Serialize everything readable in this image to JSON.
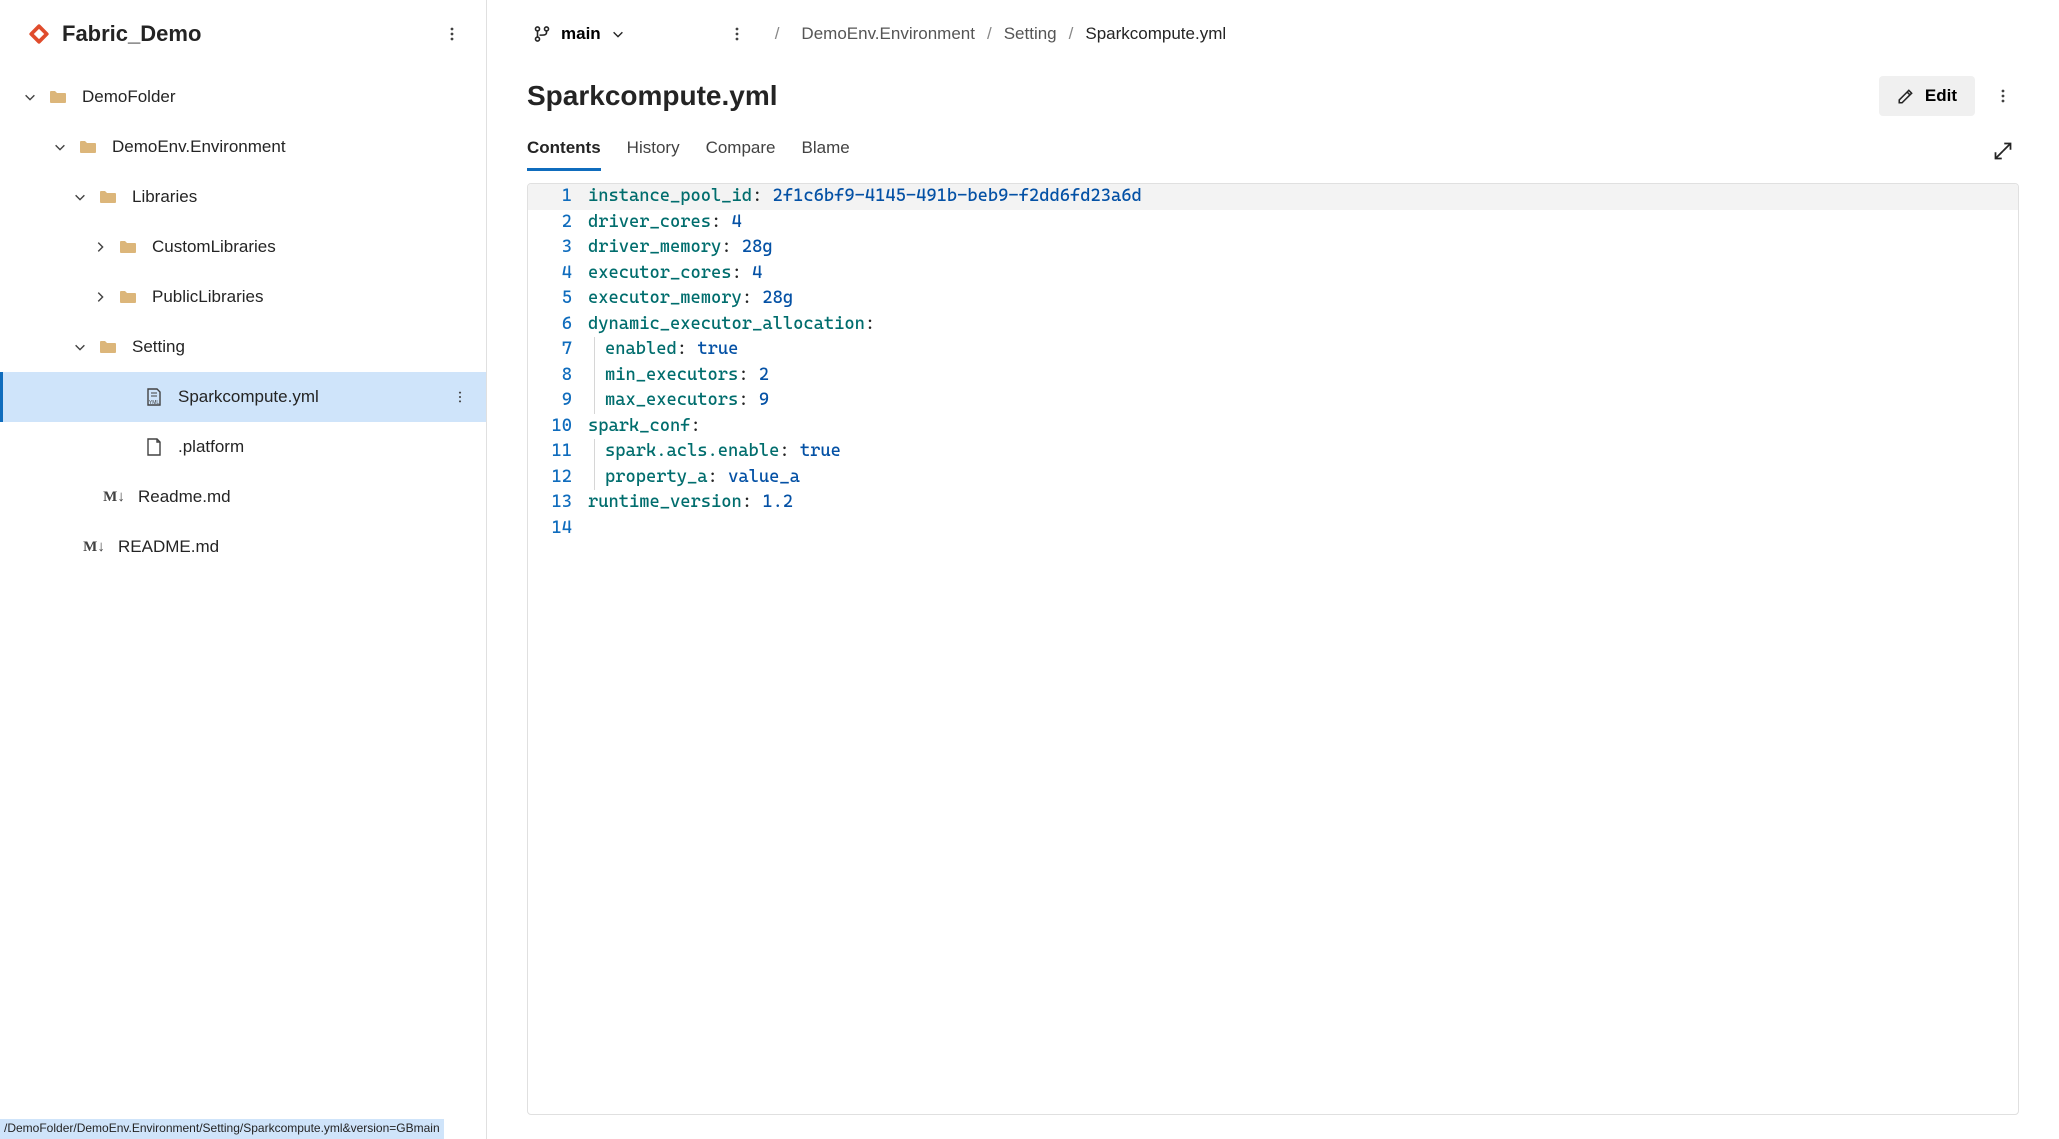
{
  "sidebar": {
    "repo_name": "Fabric_Demo",
    "status_path": "/DemoFolder/DemoEnv.Environment/Setting/Sparkcompute.yml&version=GBmain",
    "tree": [
      {
        "id": "demofolder",
        "label": "DemoFolder",
        "kind": "folder",
        "indent": 0,
        "expanded": true
      },
      {
        "id": "demoenv",
        "label": "DemoEnv.Environment",
        "kind": "folder",
        "indent": 1,
        "expanded": true
      },
      {
        "id": "libraries",
        "label": "Libraries",
        "kind": "folder",
        "indent": 2,
        "expanded": true
      },
      {
        "id": "customlibs",
        "label": "CustomLibraries",
        "kind": "folder",
        "indent": 3,
        "expanded": false
      },
      {
        "id": "publiclibs",
        "label": "PublicLibraries",
        "kind": "folder",
        "indent": 3,
        "expanded": false
      },
      {
        "id": "setting",
        "label": "Setting",
        "kind": "folder",
        "indent": 2,
        "expanded": true
      },
      {
        "id": "sparkcompute",
        "label": "Sparkcompute.yml",
        "kind": "yml",
        "indent": 4,
        "selected": true
      },
      {
        "id": "platform",
        "label": ".platform",
        "kind": "file",
        "indent": 4
      },
      {
        "id": "readme1",
        "label": "Readme.md",
        "kind": "md",
        "indent": 2
      },
      {
        "id": "readme2",
        "label": "README.md",
        "kind": "md",
        "indent": 1
      }
    ]
  },
  "main": {
    "branch": "main",
    "breadcrumbs": [
      "DemoEnv.Environment",
      "Setting",
      "Sparkcompute.yml"
    ],
    "file_title": "Sparkcompute.yml",
    "edit_label": "Edit",
    "tabs": [
      "Contents",
      "History",
      "Compare",
      "Blame"
    ],
    "active_tab": 0,
    "code": [
      {
        "n": 1,
        "indent": 0,
        "key": "instance_pool_id",
        "val": "2f1c6bf9-4145-491b-beb9-f2dd6fd23a6d",
        "hl": true
      },
      {
        "n": 2,
        "indent": 0,
        "key": "driver_cores",
        "val": "4"
      },
      {
        "n": 3,
        "indent": 0,
        "key": "driver_memory",
        "val": "28g"
      },
      {
        "n": 4,
        "indent": 0,
        "key": "executor_cores",
        "val": "4"
      },
      {
        "n": 5,
        "indent": 0,
        "key": "executor_memory",
        "val": "28g"
      },
      {
        "n": 6,
        "indent": 0,
        "key": "dynamic_executor_allocation",
        "val": ""
      },
      {
        "n": 7,
        "indent": 1,
        "key": "enabled",
        "val": "true"
      },
      {
        "n": 8,
        "indent": 1,
        "key": "min_executors",
        "val": "2"
      },
      {
        "n": 9,
        "indent": 1,
        "key": "max_executors",
        "val": "9"
      },
      {
        "n": 10,
        "indent": 0,
        "key": "spark_conf",
        "val": ""
      },
      {
        "n": 11,
        "indent": 1,
        "key": "spark.acls.enable",
        "val": "true"
      },
      {
        "n": 12,
        "indent": 1,
        "key": "property_a",
        "val": "value_a"
      },
      {
        "n": 13,
        "indent": 0,
        "key": "runtime_version",
        "val": "1.2"
      },
      {
        "n": 14,
        "indent": 0,
        "key": "",
        "val": ""
      }
    ]
  }
}
